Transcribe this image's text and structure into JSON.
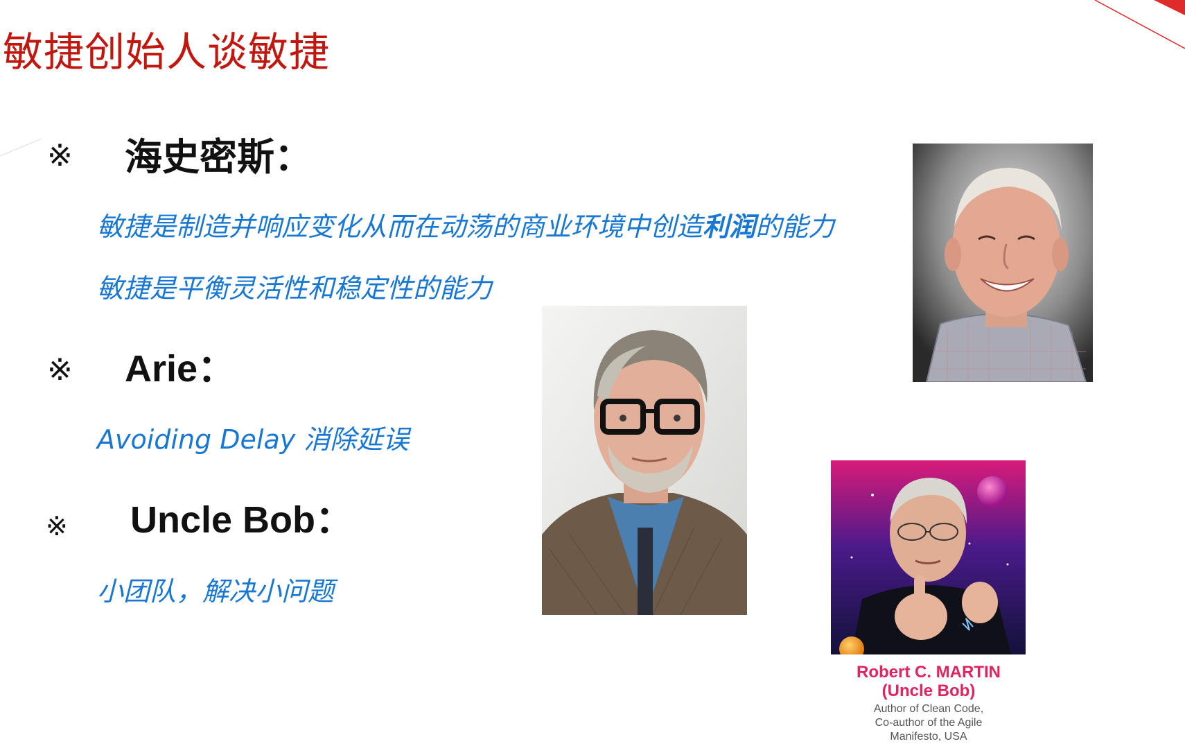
{
  "slide": {
    "title": "敏捷创始人谈敏捷",
    "bullet_symbol": "※",
    "accent_color": "#c0170f",
    "quote_color": "#1877d2"
  },
  "sections": [
    {
      "heading": "海史密斯：",
      "quotes": [
        {
          "pre": "敏捷是制造并响应变化从而在动荡的商业环境中创造",
          "bold": "利润",
          "post": "的能力"
        },
        {
          "pre": "敏捷是平衡灵活性和稳定性的能力",
          "bold": "",
          "post": ""
        }
      ]
    },
    {
      "heading": "Arie：",
      "quotes": [
        {
          "pre": "Avoiding Delay 消除延误",
          "bold": "",
          "post": ""
        }
      ]
    },
    {
      "heading": "Uncle Bob：",
      "quotes": [
        {
          "pre": "小团队，解决小问题",
          "bold": "",
          "post": ""
        }
      ]
    }
  ],
  "photos": {
    "highsmith": "portrait-photo",
    "arie": "portrait-photo",
    "uncle_bob": "portrait-photo"
  },
  "uncle_bob_caption": {
    "name_line1": "Robert C. MARTIN",
    "name_line2": "(Uncle Bob)",
    "desc_line1": "Author of Clean Code,",
    "desc_line2": "Co-author of the Agile",
    "desc_line3": "Manifesto, USA"
  }
}
